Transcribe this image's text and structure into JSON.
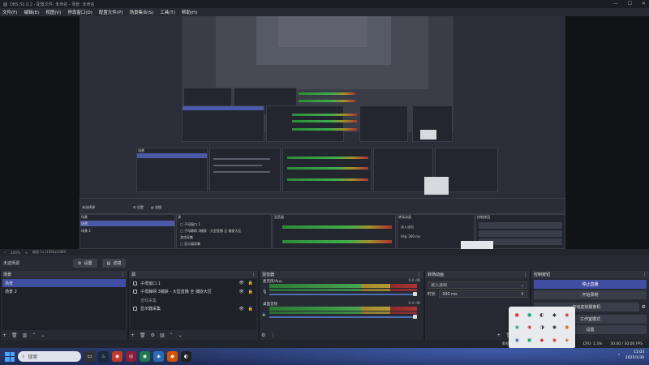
{
  "window": {
    "title": "OBS 31.0.2 - 配置文件: 未命名 - 场景: 未命名",
    "controls": [
      "—",
      "☐",
      "✕"
    ]
  },
  "menu": [
    "文件(F)",
    "编辑(E)",
    "视图(V)",
    "停靠窗口(D)",
    "配置文件(P)",
    "场景集合(S)",
    "工具(T)",
    "帮助(H)"
  ],
  "zoom": {
    "value": "100%",
    "scale_label": "缩放 1x (1920x1080)"
  },
  "toolbar": {
    "no_source_label": "未选择源",
    "properties_label": "设置",
    "filters_label": "滤镜"
  },
  "scenes": {
    "title": "场景",
    "items": [
      {
        "label": "场景",
        "active": true
      },
      {
        "label": "场景 2",
        "active": false
      }
    ]
  },
  "sources": {
    "title": "源",
    "items": [
      {
        "label": "子母窗口 1",
        "dim": false
      },
      {
        "label": "子母静网 3捕获 - 大型直播 全 捕捉大区",
        "dim": false
      },
      {
        "label": "游戏采集",
        "dim": true
      },
      {
        "label": "显示器采集",
        "dim": false
      }
    ]
  },
  "mixer": {
    "title": "混音器",
    "channels": [
      {
        "name": "麦克风/Aux",
        "db": "0.0 dB"
      },
      {
        "name": "桌面音频",
        "db": "0.0 dB"
      }
    ]
  },
  "transitions": {
    "title": "转场动画",
    "selected": "淡入淡出",
    "duration_label": "时长",
    "duration": "300 ms"
  },
  "controls": {
    "title": "控制按钮",
    "buttons": [
      {
        "label": "停止直播",
        "primary": true
      },
      {
        "label": "开始录制",
        "primary": false
      },
      {
        "label": "启动虚拟摄像机",
        "primary": false
      },
      {
        "label": "工作室模式",
        "primary": false
      },
      {
        "label": "设置",
        "primary": false
      }
    ]
  },
  "status": {
    "frames": "丢帧 0 (0.0%)",
    "time1": "00:00:00",
    "time2": "00:00:00",
    "cpu": "CPU: 1.3%",
    "fps": "30.00 / 30.00 FPS"
  },
  "taskbar": {
    "search_placeholder": "搜索",
    "time": "11:03",
    "date": "2025/1/30"
  },
  "colors": {
    "accent": "#3f4ea0",
    "panel": "#272a33",
    "meter_green": "#46a550",
    "meter_yellow": "#b39a36",
    "meter_red": "#a33333"
  }
}
